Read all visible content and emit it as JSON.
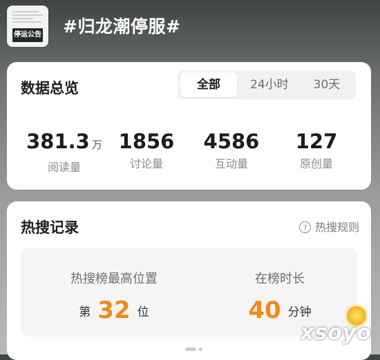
{
  "header": {
    "thumbnail_text": "停运公告",
    "topic_title": "#归龙潮停服#"
  },
  "overview": {
    "title": "数据总览",
    "tabs": [
      {
        "label": "全部",
        "active": true
      },
      {
        "label": "24小时",
        "active": false
      },
      {
        "label": "30天",
        "active": false
      }
    ],
    "stats": [
      {
        "value": "381.3",
        "unit": "万",
        "label": "阅读量"
      },
      {
        "value": "1856",
        "unit": "",
        "label": "讨论量"
      },
      {
        "value": "4586",
        "unit": "",
        "label": "互动量"
      },
      {
        "value": "127",
        "unit": "",
        "label": "原创量"
      }
    ]
  },
  "hot_search": {
    "title": "热搜记录",
    "rules_link": "热搜规则",
    "peak": {
      "label": "热搜榜最高位置",
      "prefix": "第",
      "value": "32",
      "suffix": "位"
    },
    "duration": {
      "label": "在榜时长",
      "value": "40",
      "suffix": "分钟"
    }
  },
  "watermark": "xsoyo",
  "colors": {
    "accent_orange": "#f2871c",
    "card_bg": "#ffffff",
    "panel_bg": "#f5f5f5"
  }
}
